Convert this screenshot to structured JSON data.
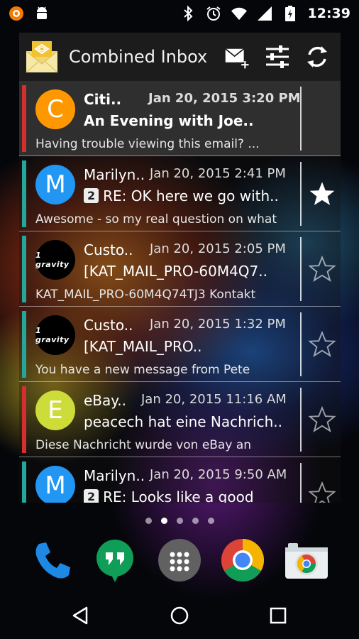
{
  "status_bar": {
    "time": "12:39",
    "left_icons": [
      "notification-app-icon",
      "android-icon"
    ],
    "right_icons": [
      "bluetooth-icon",
      "alarm-icon",
      "wifi-icon",
      "signal-icon",
      "battery-charging-icon"
    ]
  },
  "widget": {
    "title": "Combined Inbox",
    "actions": [
      "compose-icon",
      "filter-settings-icon",
      "refresh-icon"
    ],
    "messages": [
      {
        "avatar_letter": "C",
        "avatar_color": "#ff9800",
        "bar_color": "#d32f2f",
        "sender": "Citi..",
        "date": "Jan 20, 2015 3:20 PM",
        "count": "",
        "subject": "An Evening with Joe..",
        "preview": "Having trouble viewing this email? ...",
        "unread": true,
        "starred": false
      },
      {
        "avatar_letter": "M",
        "avatar_color": "#2196f3",
        "bar_color": "#26a69a",
        "sender": "Marilyn..",
        "date": "Jan 20, 2015 2:41 PM",
        "count": "2",
        "subject": "RE: OK here we go with..",
        "preview": "Awesome - so my real question on what",
        "unread": false,
        "starred": true
      },
      {
        "avatar_letter": "1 gravity",
        "avatar_color": "#000000",
        "bar_color": "#26a69a",
        "sender": "Custo..",
        "date": "Jan 20, 2015 2:05 PM",
        "count": "",
        "subject": "[KAT_MAIL_PRO-60M4Q7..",
        "preview": "KAT_MAIL_PRO-60M4Q74TJ3 Kontakt",
        "unread": false,
        "starred": false
      },
      {
        "avatar_letter": "1 gravity",
        "avatar_color": "#000000",
        "bar_color": "#26a69a",
        "sender": "Custo..",
        "date": "Jan 20, 2015 1:32 PM",
        "count": "",
        "subject": "[KAT_MAIL_PRO..",
        "preview": "You have a new message from Pete",
        "unread": false,
        "starred": false
      },
      {
        "avatar_letter": "E",
        "avatar_color": "#cddc39",
        "bar_color": "#d32f2f",
        "sender": "eBay..",
        "date": "Jan 20, 2015 11:16 AM",
        "count": "",
        "subject": "peacech hat eine Nachrich..",
        "preview": "Diese Nachricht wurde von eBay an",
        "unread": false,
        "starred": false
      },
      {
        "avatar_letter": "M",
        "avatar_color": "#2196f3",
        "bar_color": "#26a69a",
        "sender": "Marilyn..",
        "date": "Jan 20, 2015 9:50 AM",
        "count": "2",
        "subject": "RE: Looks like a good",
        "preview": "",
        "unread": false,
        "starred": false
      }
    ]
  },
  "home": {
    "page_count": 5,
    "active_page": 1,
    "dock": [
      "phone-icon",
      "hangouts-icon",
      "app-drawer-icon",
      "chrome-icon",
      "camera-icon"
    ]
  },
  "nav": [
    "back-icon",
    "home-icon",
    "recents-icon"
  ]
}
